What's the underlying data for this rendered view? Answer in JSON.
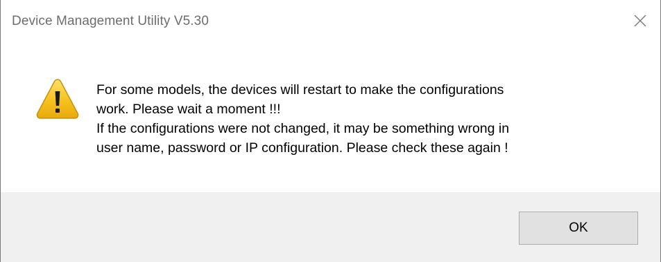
{
  "window": {
    "title": "Device Management Utility V5.30",
    "close_icon": "close-icon"
  },
  "dialog": {
    "icon": "warning-icon",
    "message_lines": [
      "For some models, the devices will restart to make the configurations",
      "work. Please wait a moment !!!",
      "If the configurations were not changed, it may be something wrong in",
      "user name, password or IP configuration. Please check these again !"
    ]
  },
  "buttons": {
    "ok_label": "OK"
  },
  "colors": {
    "footer_bg": "#f0f0f0",
    "button_bg": "#e1e1e1",
    "warning_yellow": "#f7c325"
  }
}
